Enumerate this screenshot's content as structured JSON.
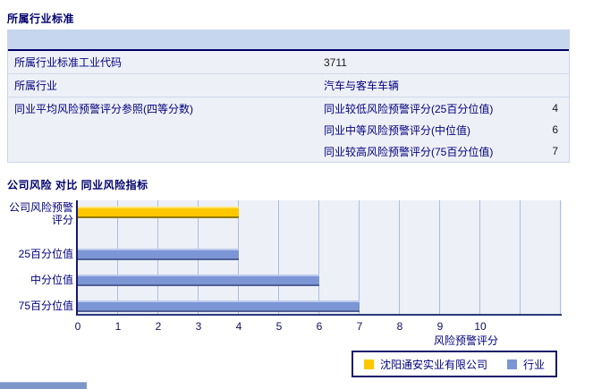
{
  "section1": {
    "title": "所属行业标准",
    "table": {
      "rows": [
        {
          "label": "所属行业标准工业代码",
          "value": "3711"
        },
        {
          "label": "所属行业",
          "value": "汽车与客车车辆"
        },
        {
          "label": "同业平均风险预警评分参照(四等分数)",
          "subrows": [
            {
              "label": "同业较低风险预警评分(25百分位值)",
              "value": "4"
            },
            {
              "label": "同业中等风险预警评分(中位值)",
              "value": "6"
            },
            {
              "label": "同业较高风险预警评分(75百分位值)",
              "value": "7"
            }
          ]
        }
      ]
    }
  },
  "section2": {
    "title": "公司风险 对比 同业风险指标"
  },
  "chart_data": {
    "type": "bar",
    "orientation": "horizontal",
    "title": "公司风险 对比 同业风险指标",
    "categories": [
      "公司风险预警评分",
      "25百分位值",
      "中分位值",
      "75百分位值"
    ],
    "values": [
      4,
      4,
      6,
      7
    ],
    "bar_series": [
      "company",
      "industry",
      "industry",
      "industry"
    ],
    "series_colors": {
      "company": "#fdc800",
      "industry": "#7b95d5"
    },
    "xlabel": "风险预警评分",
    "x_ticks": [
      0,
      1,
      2,
      3,
      4,
      5,
      6,
      7,
      8,
      9,
      10
    ],
    "xlim": [
      0,
      12
    ],
    "grid": true,
    "legend": [
      {
        "label": "沈阳通安实业有限公司",
        "series": "company",
        "color": "#fdc800"
      },
      {
        "label": "行业",
        "series": "industry",
        "color": "#7b95d5"
      }
    ],
    "legend_position": "bottom"
  }
}
